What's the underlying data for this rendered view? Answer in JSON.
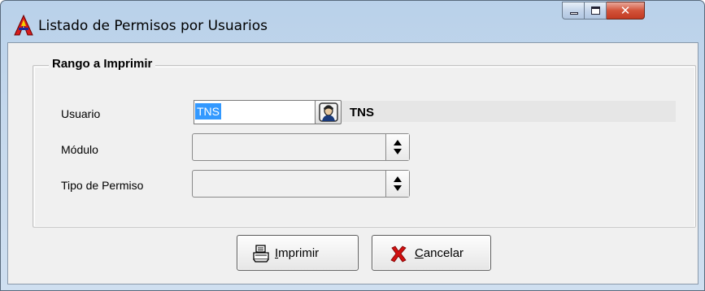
{
  "window": {
    "title": "Listado de Permisos por Usuarios",
    "controls": {
      "minimize": "minimize",
      "maximize": "maximize",
      "close": "x"
    }
  },
  "group": {
    "title": "Rango a Imprimir"
  },
  "fields": {
    "usuario": {
      "label": "Usuario",
      "value": "TNS",
      "name_display": "TNS"
    },
    "modulo": {
      "label": "Módulo",
      "value": ""
    },
    "tipo_permiso": {
      "label": "Tipo de Permiso",
      "value": ""
    }
  },
  "buttons": {
    "imprimir": {
      "accel": "I",
      "rest": "mprimir"
    },
    "cancelar": {
      "accel": "C",
      "rest": "ancelar"
    }
  },
  "icons": {
    "app": "app-logo-icon",
    "lookup": "person-lookup-icon",
    "printer": "printer-icon",
    "cancel": "red-x-icon"
  },
  "colors": {
    "selection": "#3399ff",
    "close_button": "#c23a22",
    "cancel_x": "#d01010"
  }
}
